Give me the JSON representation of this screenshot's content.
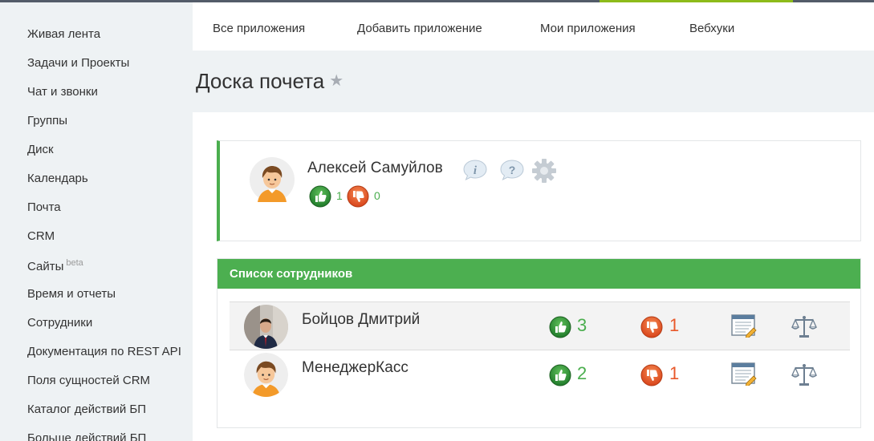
{
  "sidebar": {
    "items": [
      {
        "label": "Живая лента"
      },
      {
        "label": "Задачи и Проекты"
      },
      {
        "label": "Чат и звонки"
      },
      {
        "label": "Группы"
      },
      {
        "label": "Диск"
      },
      {
        "label": "Календарь"
      },
      {
        "label": "Почта"
      },
      {
        "label": "CRM"
      },
      {
        "label": "Сайты",
        "badge": "beta"
      },
      {
        "label": "Время и отчеты"
      },
      {
        "label": "Сотрудники"
      },
      {
        "label": "Документация по REST API"
      },
      {
        "label": "Поля сущностей CRM"
      },
      {
        "label": "Каталог действий БП"
      },
      {
        "label": "Больше действий БП"
      }
    ]
  },
  "topnav": {
    "tabs": [
      {
        "label": "Все приложения"
      },
      {
        "label": "Добавить приложение"
      },
      {
        "label": "Мои приложения"
      },
      {
        "label": "Вебхуки"
      }
    ]
  },
  "page": {
    "title": "Доска почета",
    "star_icon": "★"
  },
  "current_user": {
    "name": "Алексей Самуйлов",
    "likes": "1",
    "dislikes": "0"
  },
  "employees": {
    "header": "Список сотрудников",
    "rows": [
      {
        "name": "Бойцов Дмитрий",
        "likes": "3",
        "dislikes": "1"
      },
      {
        "name": "МенеджерКасс",
        "likes": "2",
        "dislikes": "1"
      }
    ]
  },
  "colors": {
    "accent_green": "#4caf50",
    "like_green": "#4aae4e",
    "dislike_orange": "#e8582a",
    "top_accent": "#8dbb1a"
  },
  "icons": [
    "info-icon",
    "help-icon",
    "gear-icon",
    "thumbs-up-icon",
    "thumbs-down-icon",
    "calendar-icon",
    "scales-icon",
    "star-icon"
  ]
}
